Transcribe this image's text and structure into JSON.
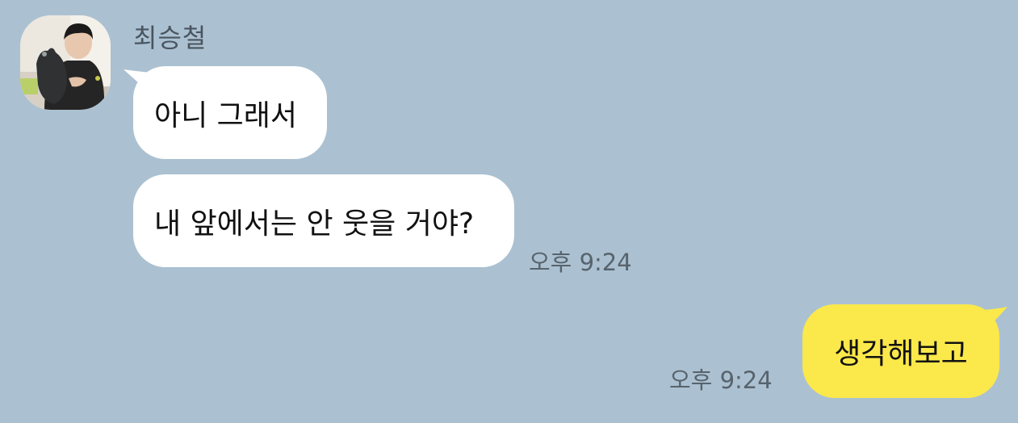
{
  "app": {
    "background": "#abc1d1",
    "incoming_bubble_color": "#ffffff",
    "outgoing_bubble_color": "#fbe84a"
  },
  "conversation": {
    "sender": {
      "name": "최승철",
      "avatar_icon": "profile-photo"
    },
    "incoming_messages": [
      {
        "text": "아니 그래서"
      },
      {
        "text": "내 앞에서는 안 웃을 거야?",
        "time": "오후 9:24"
      }
    ],
    "outgoing_messages": [
      {
        "text": "생각해보고",
        "time": "오후 9:24"
      }
    ]
  }
}
